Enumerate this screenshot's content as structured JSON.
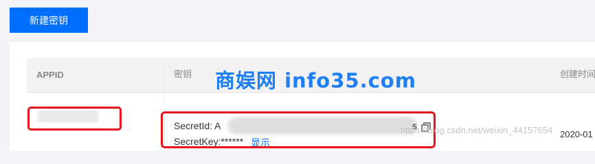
{
  "toolbar": {
    "new_key_label": "新建密钥"
  },
  "table": {
    "headers": {
      "appid": "APPID",
      "key": "密钥",
      "created": "创建时间"
    },
    "rows": [
      {
        "secret_id_label": "SecretId: A",
        "secret_id_tail": "s",
        "secret_key_label": "SecretKey:******",
        "show_label": "显示",
        "created_time": "2020-01"
      }
    ]
  },
  "overlay": {
    "watermark": "商娱网 info35.com",
    "csdn": "https://blog.csdn.net/weixin_44157654"
  },
  "colors": {
    "accent": "#006eff",
    "highlight_box": "#e3141c",
    "watermark": "#1e7ff5"
  },
  "icons": {
    "copy": "copy-icon"
  }
}
